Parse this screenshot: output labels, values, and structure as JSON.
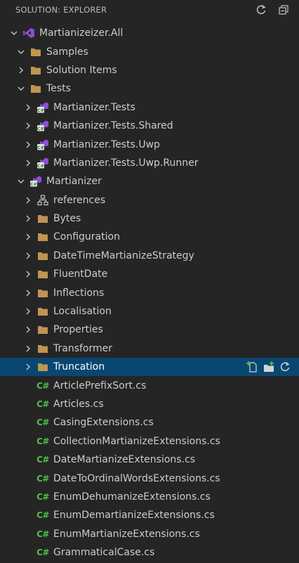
{
  "header": {
    "title": "SOLUTION: EXPLORER",
    "refresh_icon": "refresh-icon",
    "collapse_icon": "collapse-all-icon"
  },
  "tree": [
    {
      "label": "Martianizeizer.All",
      "icon": "solution-icon",
      "expanded": true,
      "level": 0
    },
    {
      "label": "Samples",
      "icon": "folder-icon",
      "expanded": true,
      "level": 1
    },
    {
      "label": "Solution Items",
      "icon": "folder-icon",
      "expanded": false,
      "level": 1
    },
    {
      "label": "Tests",
      "icon": "folder-icon",
      "expanded": true,
      "level": 1
    },
    {
      "label": "Martianizer.Tests",
      "icon": "csproj-icon",
      "expanded": false,
      "level": 2
    },
    {
      "label": "Martianizer.Tests.Shared",
      "icon": "csproj-icon",
      "expanded": false,
      "level": 2
    },
    {
      "label": "Martianizer.Tests.Uwp",
      "icon": "csproj-icon",
      "expanded": false,
      "level": 2
    },
    {
      "label": "Martianizer.Tests.Uwp.Runner",
      "icon": "csproj-icon",
      "expanded": false,
      "level": 2
    },
    {
      "label": "Martianizer",
      "icon": "csproj-icon",
      "expanded": true,
      "level": 1
    },
    {
      "label": "references",
      "icon": "references-icon",
      "expanded": false,
      "level": 2
    },
    {
      "label": "Bytes",
      "icon": "folder-icon",
      "expanded": false,
      "level": 2
    },
    {
      "label": "Configuration",
      "icon": "folder-icon",
      "expanded": false,
      "level": 2
    },
    {
      "label": "DateTimeMartianizeStrategy",
      "icon": "folder-icon",
      "expanded": false,
      "level": 2
    },
    {
      "label": "FluentDate",
      "icon": "folder-icon",
      "expanded": false,
      "level": 2
    },
    {
      "label": "Inflections",
      "icon": "folder-icon",
      "expanded": false,
      "level": 2
    },
    {
      "label": "Localisation",
      "icon": "folder-icon",
      "expanded": false,
      "level": 2
    },
    {
      "label": "Properties",
      "icon": "folder-icon",
      "expanded": false,
      "level": 2
    },
    {
      "label": "Transformer",
      "icon": "folder-icon",
      "expanded": false,
      "level": 2
    },
    {
      "label": "Truncation",
      "icon": "folder-icon",
      "expanded": false,
      "level": 2,
      "selected": true
    },
    {
      "label": "ArticlePrefixSort.cs",
      "icon": "csharp-file-icon",
      "level": 2
    },
    {
      "label": "Articles.cs",
      "icon": "csharp-file-icon",
      "level": 2
    },
    {
      "label": "CasingExtensions.cs",
      "icon": "csharp-file-icon",
      "level": 2
    },
    {
      "label": "CollectionMartianizeExtensions.cs",
      "icon": "csharp-file-icon",
      "level": 2
    },
    {
      "label": "DateMartianizeExtensions.cs",
      "icon": "csharp-file-icon",
      "level": 2
    },
    {
      "label": "DateToOrdinalWordsExtensions.cs",
      "icon": "csharp-file-icon",
      "level": 2
    },
    {
      "label": "EnumDehumanizeExtensions.cs",
      "icon": "csharp-file-icon",
      "level": 2
    },
    {
      "label": "EnumDemartianizeExtensions.cs",
      "icon": "csharp-file-icon",
      "level": 2
    },
    {
      "label": "EnumMartianizeExtensions.cs",
      "icon": "csharp-file-icon",
      "level": 2
    },
    {
      "label": "GrammaticalCase.cs",
      "icon": "csharp-file-icon",
      "level": 2
    }
  ],
  "csharp_glyph": "C#",
  "colors": {
    "background": "#252526",
    "selected": "#094771",
    "folder": "#c09553",
    "csharp": "#4ec146",
    "vs_purple": "#8c4fd0"
  }
}
